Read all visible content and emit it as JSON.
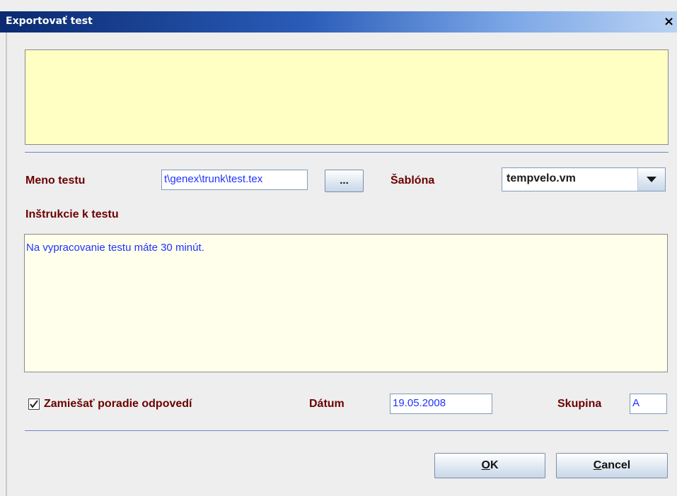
{
  "window": {
    "title": "Exportovať test",
    "close_icon": "close-icon"
  },
  "form": {
    "test_name_label": "Meno testu",
    "test_name_value": "t\\genex\\trunk\\test.tex",
    "browse_label": "...",
    "template_label": "Šablóna",
    "template_value": "tempvelo.vm",
    "instructions_label": "Inštrukcie k testu",
    "instructions_value": "Na vypracovanie testu máte 30 minút.",
    "shuffle_label": "Zamiešať poradie odpovedí",
    "shuffle_checked": true,
    "date_label": "Dátum",
    "date_value": "19.05.2008",
    "group_label": "Skupina",
    "group_value": "A"
  },
  "buttons": {
    "ok_mnemonic": "O",
    "ok_rest": "K",
    "cancel_mnemonic": "C",
    "cancel_rest": "ancel"
  },
  "colors": {
    "title_gradient_start": "#0b2a70",
    "label_color": "#6b0000",
    "input_text": "#1f33ff",
    "info_box_bg": "#ffffc4"
  }
}
